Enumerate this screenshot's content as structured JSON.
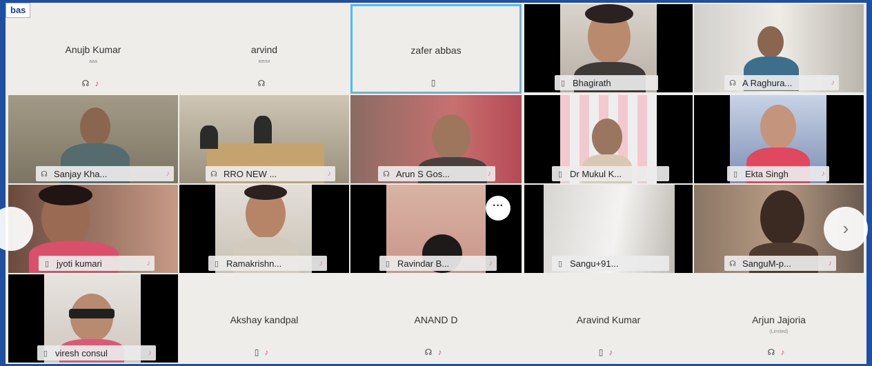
{
  "window": {
    "corner_label": "bas"
  },
  "tiles": [
    {
      "name": "Anujb Kumar",
      "sub": "ааа",
      "kind": "placeholder"
    },
    {
      "name": "arvind",
      "sub": "мели",
      "kind": "placeholder"
    },
    {
      "name": "zafer abbas",
      "kind": "placeholder",
      "active": true
    },
    {
      "name": "Bhagirath",
      "kind": "video"
    },
    {
      "name": "A Raghura...",
      "kind": "video"
    },
    {
      "name": "Sanjay Kha...",
      "kind": "video"
    },
    {
      "name": "RRO NEW ...",
      "kind": "video"
    },
    {
      "name": "Arun S Gos...",
      "kind": "video"
    },
    {
      "name": "Dr Mukul K...",
      "kind": "video"
    },
    {
      "name": "Ekta Singh",
      "kind": "video"
    },
    {
      "name": "jyoti kumari",
      "kind": "video"
    },
    {
      "name": "Ramakrishn...",
      "kind": "video"
    },
    {
      "name": "Ravindar B...",
      "kind": "video"
    },
    {
      "name": "Sangu+91...",
      "kind": "video"
    },
    {
      "name": "SanguM-p...",
      "kind": "video"
    },
    {
      "name": "viresh consul",
      "kind": "video"
    },
    {
      "name": "Akshay kandpal",
      "kind": "placeholder"
    },
    {
      "name": "ANAND D",
      "kind": "placeholder"
    },
    {
      "name": "Aravind Kumar",
      "kind": "placeholder"
    },
    {
      "name": "Arjun Jajoria",
      "sub": "(Limited)",
      "kind": "placeholder"
    }
  ],
  "controls": {
    "more_label": "···",
    "next_label": "›",
    "prev_label": ""
  },
  "icons": {
    "mic": "headset-icon",
    "device": "device-icon",
    "muted": "mic-off-icon"
  },
  "colors": {
    "background": "#1f4fa0",
    "active_border": "#5fb6e6",
    "muted": "#e05560"
  }
}
